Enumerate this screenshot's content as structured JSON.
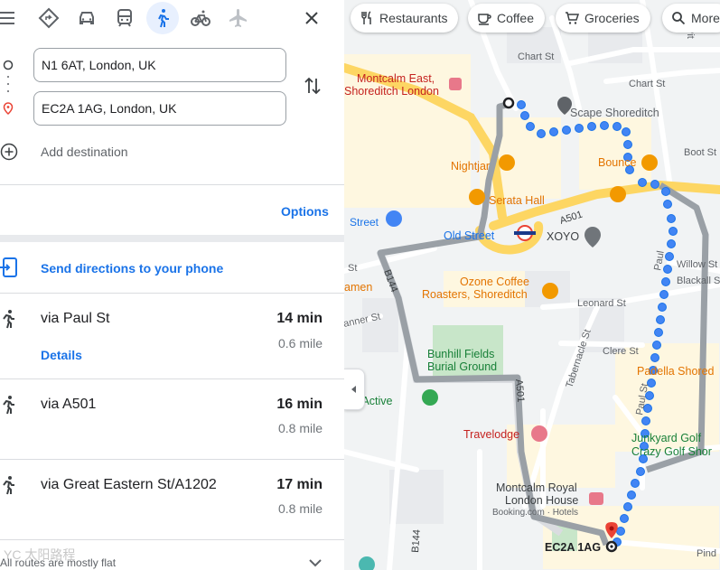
{
  "travel_modes": [
    {
      "name": "best",
      "icon": "diamond-route-icon"
    },
    {
      "name": "driving",
      "icon": "car-icon"
    },
    {
      "name": "transit",
      "icon": "train-icon"
    },
    {
      "name": "walking",
      "icon": "walk-icon",
      "active": true
    },
    {
      "name": "cycling",
      "icon": "bicycle-icon"
    },
    {
      "name": "flights",
      "icon": "plane-icon"
    }
  ],
  "origin": {
    "value": "N1 6AT, London, UK"
  },
  "destination": {
    "value": "EC2A 1AG, London, UK"
  },
  "add_destination_label": "Add destination",
  "options_label": "Options",
  "send_directions_label": "Send directions to your phone",
  "routes": [
    {
      "via": "via Paul St",
      "duration": "14 min",
      "distance": "0.6 mile",
      "details_label": "Details"
    },
    {
      "via": "via A501",
      "duration": "16 min",
      "distance": "0.8 mile"
    },
    {
      "via": "via Great Eastern St/A1202",
      "duration": "17 min",
      "distance": "0.8 mile"
    }
  ],
  "footer_note": "All routes are mostly flat",
  "watermark": "YC 太阳路程",
  "map": {
    "chips": [
      {
        "label": "Restaurants",
        "icon": "fork-knife-icon"
      },
      {
        "label": "Coffee",
        "icon": "coffee-icon"
      },
      {
        "label": "Groceries",
        "icon": "cart-icon"
      },
      {
        "label": "More",
        "icon": "search-icon"
      }
    ],
    "street_labels": {
      "chart_st_1": "Chart St",
      "chart_st_2": "Chart St",
      "pitfield": "Pit",
      "boot_st": "Boot St",
      "willow_st": "Willow St",
      "blackall": "Blackall S",
      "leonard_st": "Leonard St",
      "tabernacle_st": "Tabernacle St",
      "clere_st": "Clere St",
      "paul_st": "Paul St",
      "paul_st_2": "Paul",
      "a501_top": "A501",
      "a501_mid": "A501",
      "b144_top": "B144",
      "b144_bottom": "B144",
      "st_left": "St",
      "anner_st": "anner St",
      "pind": "Pind",
      "street_left": "Street"
    },
    "places": {
      "montcalm_east": "Montcalm East,",
      "montcalm_east_2": "Shoreditch London",
      "scape": "Scape Shoreditch",
      "nightjar": "Nightjar",
      "bounce": "Bounce",
      "serata": "Serata Hall",
      "old_street": "Old Street",
      "xoyo": "XOYO",
      "ozone": "Ozone Coffee",
      "ozone_2": "Roasters, Shoreditch",
      "amen": "amen",
      "bunhill": "Bunhill Fields",
      "bunhill_2": "Burial Ground",
      "padella": "Padella Shored",
      "gin_active": "gin Active",
      "travelodge": "Travelodge",
      "junkyard": "Junkyard Golf",
      "crazy_golf": "Crazy Golf Shor",
      "montcalm_royal": "Montcalm Royal",
      "london_house": "London House",
      "booking": "Booking.com · Hotels",
      "destination_label": "EC2A 1AG"
    },
    "colors": {
      "route_primary": "#1a73e8",
      "route_alt": "#9aa0a6",
      "park": "#c8e6c9",
      "road_major": "#fdd663",
      "poi_orange": "#f29900"
    }
  }
}
